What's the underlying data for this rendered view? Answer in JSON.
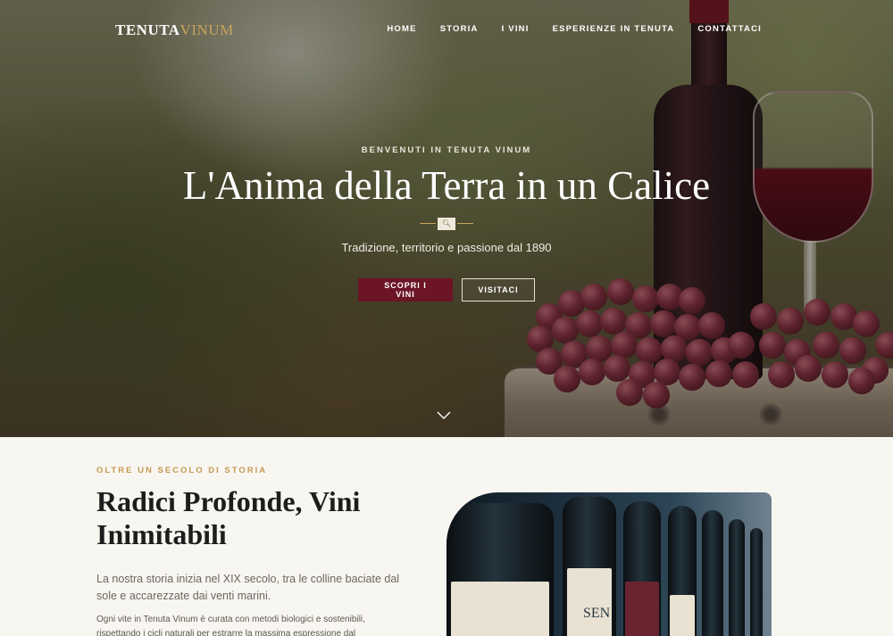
{
  "brand": {
    "name_part1": "TENUTA",
    "name_part2": "VINUM",
    "accent_color": "#c9a35a"
  },
  "nav": {
    "items": [
      {
        "label": "HOME"
      },
      {
        "label": "STORIA"
      },
      {
        "label": "I VINI"
      },
      {
        "label": "ESPERIENZE IN TENUTA"
      },
      {
        "label": "CONTATTACI"
      }
    ]
  },
  "hero": {
    "eyebrow": "BENVENUTI IN TENUTA VINUM",
    "title": "L'Anima della Terra in un Calice",
    "divider_icon": "magnifier-icon",
    "subtitle": "Tradizione, territorio e passione dal 1890",
    "primary_button": "SCOPRI I VINI",
    "secondary_button": "VISITACI",
    "primary_color": "#6b1526",
    "scroll_icon": "chevron-down-icon"
  },
  "story": {
    "eyebrow": "OLTRE UN SECOLO DI STORIA",
    "title_line1": "Radici Profonde, Vini",
    "title_line2": "Inimitabili",
    "paragraph1": "La nostra storia inizia nel XIX secolo, tra le colline baciate dal sole e accarezzate dai venti marini.",
    "paragraph2": "Ogni vite in Tenuta Vinum è curata con metodi biologici e sostenibili, rispettando i cicli naturali per estrarre la massima espressione dal",
    "image_label_text": "SEN"
  }
}
